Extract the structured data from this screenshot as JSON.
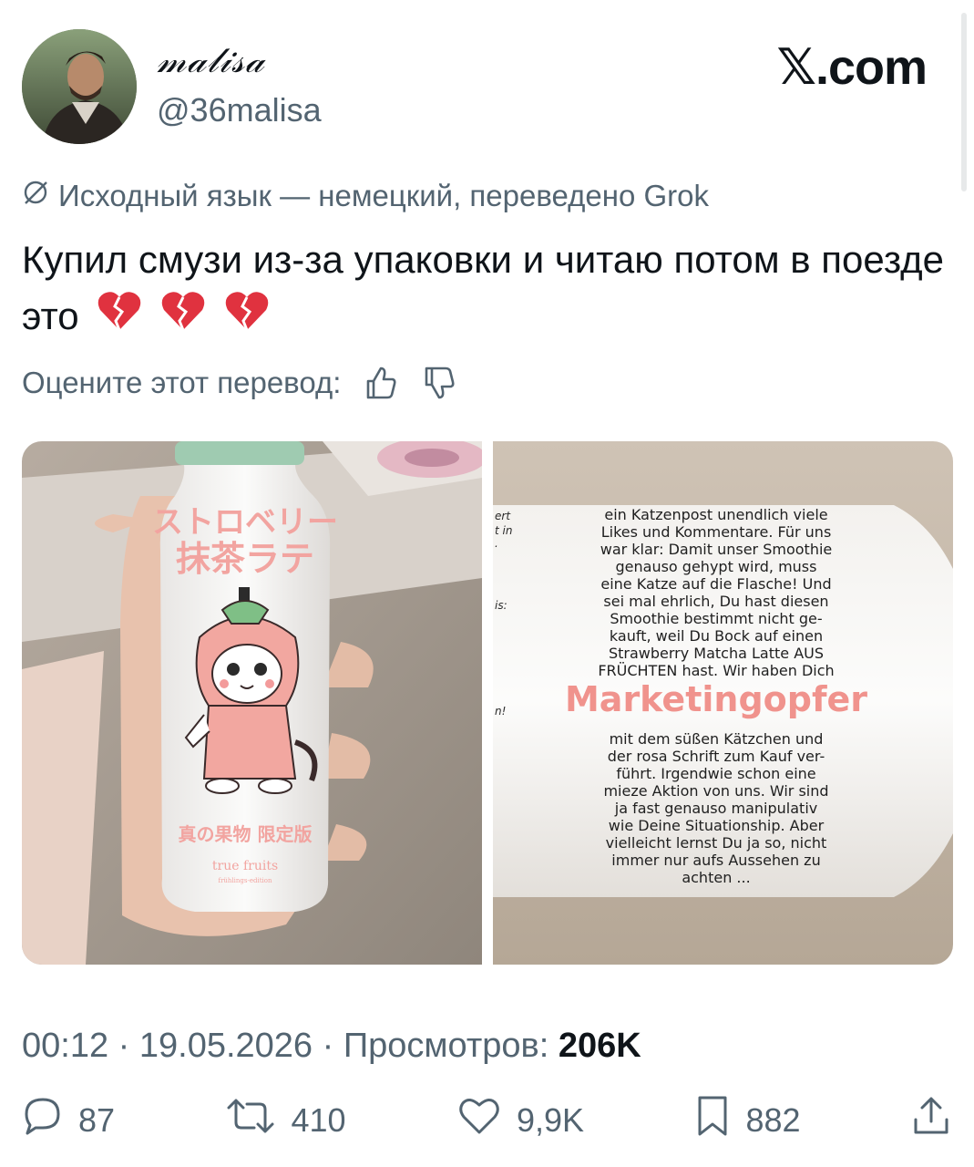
{
  "author": {
    "display_name": "𝓂𝒶𝓁𝒾𝓈𝒶",
    "handle": "@36malisa"
  },
  "brand": "𝕏.com",
  "translation_note": "Исходный язык — немецкий, переведено Grok",
  "tweet_text": "Купил смузи из-за упаковки и читаю потом в поезде это",
  "emoji": [
    "broken-heart",
    "broken-heart",
    "broken-heart"
  ],
  "rate": {
    "label": "Оцените этот перевод:"
  },
  "media": {
    "left": {
      "jp_line1": "ストロベリー",
      "jp_line2": "抹茶ラテ",
      "jp_bottom": "真の果物 限定版",
      "brand": "true fruits",
      "brand_sub": "frühlings-edition"
    },
    "right": {
      "text_lines": [
        "ein Katzenpost unendlich viele",
        "Likes und Kommentare. Für uns",
        "war klar: Damit unser Smoothie",
        "genauso gehypt wird, muss",
        "eine Katze auf die Flasche! Und",
        "sei mal ehrlich, Du hast diesen",
        "Smoothie bestimmt nicht ge-",
        "kauft, weil Du Bock auf einen",
        "Strawberry Matcha Latte AUS",
        "FRÜCHTEN hast. Wir haben Dich"
      ],
      "headline": "Marketingopfer",
      "text_lines_2": [
        "mit dem süßen Kätzchen und",
        "der rosa Schrift zum Kauf ver-",
        "führt. Irgendwie schon eine",
        "mieze Aktion von uns. Wir sind",
        "ja fast genauso manipulativ",
        "wie Deine Situationship. Aber",
        "vielleicht lernst Du ja so, nicht",
        "immer nur aufs Aussehen zu",
        "achten ..."
      ],
      "edge_left": [
        "ert",
        "t in",
        ".",
        "is:",
        "n!"
      ]
    }
  },
  "meta": {
    "time": "00:12",
    "date": "19.05.2026",
    "views_label": "Просмотров:",
    "views": "206K"
  },
  "actions": {
    "replies": "87",
    "reposts": "410",
    "likes": "9,9K",
    "bookmarks": "882"
  }
}
